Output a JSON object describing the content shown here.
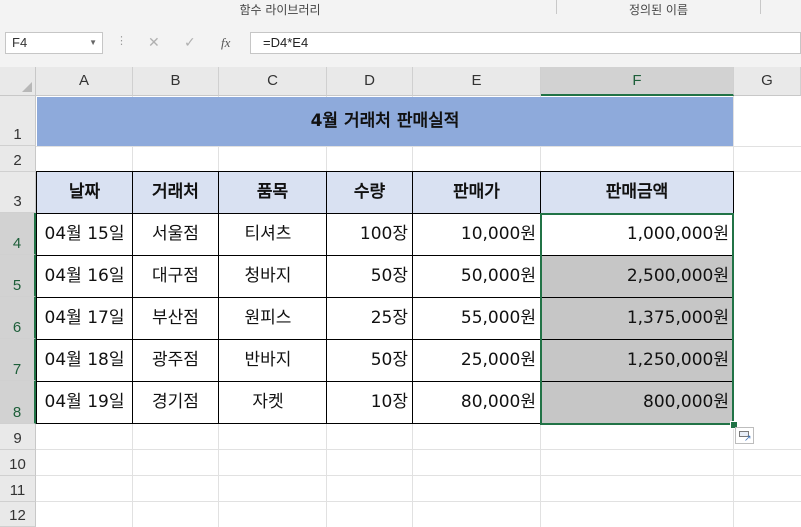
{
  "ribbon": {
    "group_left": "함수 라이브러리",
    "group_right": "정의된 이름"
  },
  "formula_bar": {
    "name_box": "F4",
    "cancel_icon": "close-icon",
    "enter_icon": "check-icon",
    "fx_label": "fx",
    "formula": "=D4*E4"
  },
  "columns": [
    "A",
    "B",
    "C",
    "D",
    "E",
    "F",
    "G"
  ],
  "rows": [
    "1",
    "2",
    "3",
    "4",
    "5",
    "6",
    "7",
    "8",
    "9",
    "10",
    "11",
    "12"
  ],
  "sheet": {
    "title": "4월 거래처 판매실적",
    "headers": [
      "날짜",
      "거래처",
      "품목",
      "수량",
      "판매가",
      "판매금액"
    ],
    "records": [
      [
        "04월 15일",
        "서울점",
        "티셔츠",
        "100장",
        "10,000원",
        "1,000,000원"
      ],
      [
        "04월 16일",
        "대구점",
        "청바지",
        "50장",
        "50,000원",
        "2,500,000원"
      ],
      [
        "04월 17일",
        "부산점",
        "원피스",
        "25장",
        "55,000원",
        "1,375,000원"
      ],
      [
        "04월 18일",
        "광주점",
        "반바지",
        "50장",
        "25,000원",
        "1,250,000원"
      ],
      [
        "04월 19일",
        "경기점",
        "자켓",
        "10장",
        "80,000원",
        "800,000원"
      ]
    ]
  },
  "colors": {
    "title_fill": "#8eaadb",
    "header_fill": "#d9e1f2",
    "selection": "#217346",
    "result_fill": "#c6c6c6"
  }
}
